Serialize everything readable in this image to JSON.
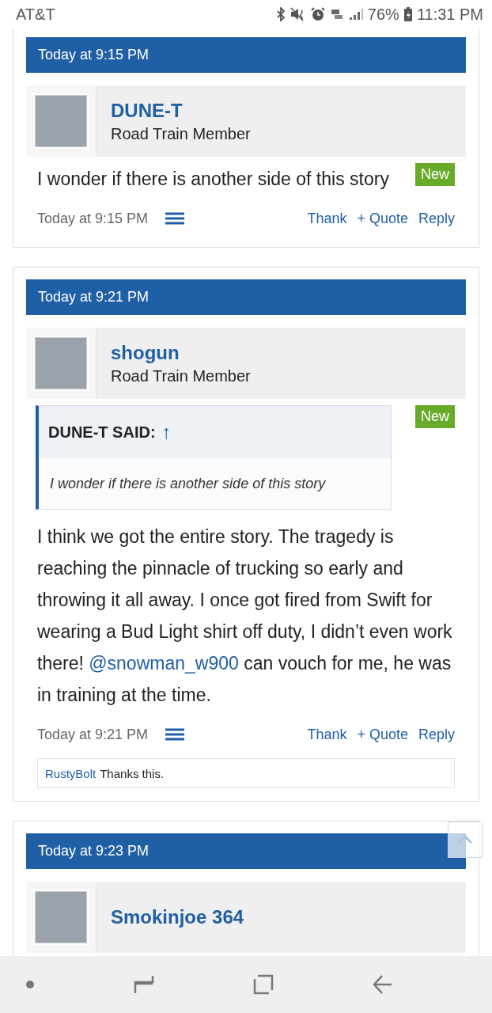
{
  "status_bar": {
    "carrier": "AT&T",
    "battery": "76%",
    "time": "11:31 PM"
  },
  "posts": [
    {
      "date": "Today at 9:15 PM",
      "user": {
        "name": "DUNE-T",
        "role": "Road Train Member"
      },
      "new_badge": "New",
      "body": [
        {
          "kind": "text",
          "text": "I wonder if there is another side of this story"
        }
      ],
      "footer_time": "Today at 9:15 PM",
      "actions": [
        "Thank",
        "+ Quote",
        "Reply"
      ]
    },
    {
      "date": "Today at 9:21 PM",
      "user": {
        "name": "shogun",
        "role": "Road Train Member"
      },
      "new_badge": "New",
      "quote": {
        "author": "DUNE-T SAID:",
        "arrow": "↑",
        "text": "I wonder if there is another side of this story"
      },
      "body": [
        {
          "kind": "text",
          "text": "I think we got the entire story. The tragedy is reaching the pinnacle of trucking so early and throwing it all away. I once got fired from Swift for wearing a Bud Light shirt off duty, I didn’t even work there! "
        },
        {
          "kind": "mention",
          "text": "@snowman_w900"
        },
        {
          "kind": "text",
          "text": " can vouch for me, he was in training at the time."
        }
      ],
      "footer_time": "Today at 9:21 PM",
      "actions": [
        "Thank",
        "+ Quote",
        "Reply"
      ],
      "likes": {
        "user": "RustyBolt",
        "text": "Thanks this."
      }
    },
    {
      "date": "Today at 9:23 PM",
      "user": {
        "name": "Smokinjoe 364"
      }
    }
  ]
}
